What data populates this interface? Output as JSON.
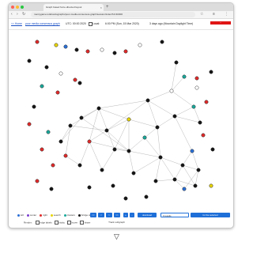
{
  "browser": {
    "tab_title": "Graph based force-directed layout",
    "tab_close": "×",
    "newtab": "+",
    "url": "mercygame.io/abouttographs/poor-media-consensus-graph/session/index?id=40000",
    "back": "‹",
    "forward": "›",
    "reload": "↻",
    "home": "⌂",
    "tool_icons": [
      "☆",
      "≡",
      "⋮"
    ]
  },
  "infobar": {
    "home_link": "<< Home",
    "graph_link": "poor media consensus graph",
    "utc_label": "UTC: 00:00 2020",
    "local_label": "Local:",
    "time_value": "6:00 PM (Sun, 15 Mar 2020)",
    "ago_label": "3 days ago (Mountain Daylight Time)",
    "red_badge": "~"
  },
  "graph": {
    "colors": {
      "black": "#151515",
      "red": "#e02a2a",
      "teal": "#1aa89a",
      "blue": "#2a6fd6",
      "yellow": "#e8d500",
      "white": "#ffffff",
      "purple": "#7a3fcf",
      "edge": "#9a9a9a"
    }
  },
  "controls": {
    "legend": [
      {
        "label": "left",
        "color": "#2a6fd6"
      },
      {
        "label": "center",
        "color": "#7a3fcf"
      },
      {
        "label": "right",
        "color": "#e02a2a"
      },
      {
        "label": "search",
        "color": "#e8d500"
      },
      {
        "label": "clusters",
        "color": "#1aa89a"
      },
      {
        "label": "bridge stories",
        "color": "#151515"
      }
    ],
    "buttons": [
      "<<",
      "<",
      ">",
      ">>",
      "+",
      "-",
      "download"
    ],
    "selected_field": "0 results",
    "selected_button": "for the selected",
    "row2": {
      "render_label": "Render:",
      "edge_label": "edge labels",
      "sticky_label": "sticky",
      "hover_label": "hover",
      "share_label": "share",
      "track_label": "Track subgraph"
    }
  },
  "bottom_arrow": "▽"
}
